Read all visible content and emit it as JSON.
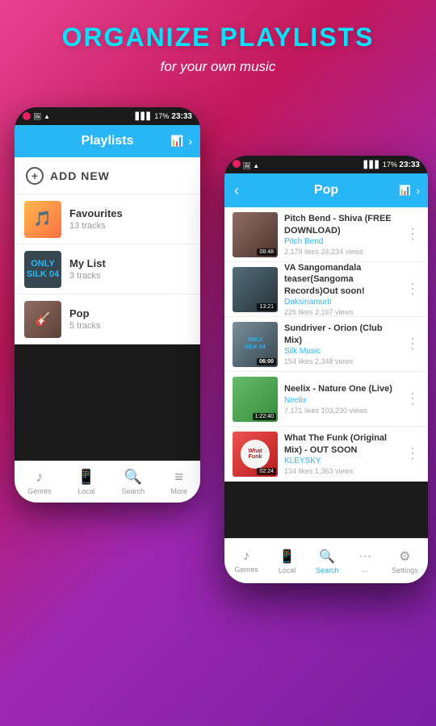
{
  "hero": {
    "title": "ORGANIZE PLAYLISTS",
    "subtitle": "for your own music"
  },
  "left_phone": {
    "status_bar": {
      "time": "23:33",
      "battery": "17%"
    },
    "header": {
      "title": "Playlists"
    },
    "add_new_label": "ADD NEW",
    "playlists": [
      {
        "name": "Favourites",
        "tracks": "13 tracks"
      },
      {
        "name": "My List",
        "tracks": "3 tracks"
      },
      {
        "name": "Pop",
        "tracks": "5 tracks"
      }
    ],
    "bottom_nav": [
      {
        "label": "Genres",
        "active": false
      },
      {
        "label": "Local",
        "active": false
      },
      {
        "label": "Search",
        "active": false
      },
      {
        "label": "More",
        "active": false
      }
    ]
  },
  "right_phone": {
    "status_bar": {
      "time": "23:33",
      "battery": "17%"
    },
    "header": {
      "title": "Pop"
    },
    "tracks": [
      {
        "name": "Pitch Bend - Shiva  (FREE DOWNLOAD)",
        "artist": "Pitch Bend",
        "stats": "2,179 likes   24,234 views",
        "duration": "08:48"
      },
      {
        "name": "VA Sangomandala teaser(Sangoma Records)Out soon!",
        "artist": "Daksinamurti",
        "stats": "226 likes   2,167 views",
        "duration": "13:21"
      },
      {
        "name": "Sundriver - Orion (Club Mix)",
        "artist": "Silk Music",
        "stats": "154 likes   2,348 views",
        "duration": "06:00"
      },
      {
        "name": "Neelix - Nature One (Live)",
        "artist": "Neelix",
        "stats": "7,171 likes   103,230 views",
        "duration": "1:22:40"
      },
      {
        "name": "What The Funk (Original Mix) - OUT SOON",
        "artist": "KLEYSKY",
        "stats": "134 likes   1,363 views",
        "duration": "02:24"
      }
    ],
    "bottom_nav": [
      {
        "label": "Genres",
        "active": false
      },
      {
        "label": "Local",
        "active": false
      },
      {
        "label": "Search",
        "active": true
      },
      {
        "label": "...",
        "active": false
      },
      {
        "label": "Settings",
        "active": false
      }
    ]
  }
}
